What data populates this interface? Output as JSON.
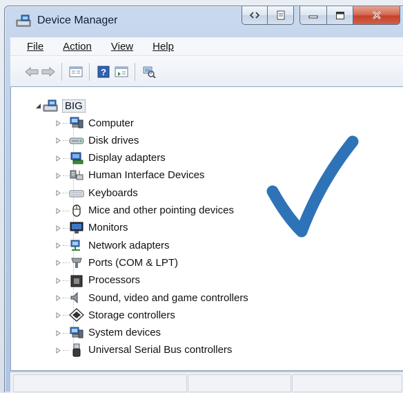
{
  "window": {
    "title": "Device Manager"
  },
  "menu": {
    "file": "File",
    "action": "Action",
    "view": "View",
    "help": "Help"
  },
  "toolbar": {
    "buttons": [
      "back-arrow-icon",
      "forward-arrow-icon",
      "properties-icon",
      "help-icon",
      "update-driver-icon",
      "scan-hardware-icon"
    ]
  },
  "tree": {
    "root": "BIG",
    "items": [
      {
        "label": "Computer",
        "icon": "computer-icon"
      },
      {
        "label": "Disk drives",
        "icon": "disk-drive-icon"
      },
      {
        "label": "Display adapters",
        "icon": "display-adapter-icon"
      },
      {
        "label": "Human Interface Devices",
        "icon": "hid-icon"
      },
      {
        "label": "Keyboards",
        "icon": "keyboard-icon"
      },
      {
        "label": "Mice and other pointing devices",
        "icon": "mouse-icon"
      },
      {
        "label": "Monitors",
        "icon": "monitor-icon"
      },
      {
        "label": "Network adapters",
        "icon": "network-adapter-icon"
      },
      {
        "label": "Ports (COM & LPT)",
        "icon": "port-icon"
      },
      {
        "label": "Processors",
        "icon": "processor-icon"
      },
      {
        "label": "Sound, video and game controllers",
        "icon": "sound-icon"
      },
      {
        "label": "Storage controllers",
        "icon": "storage-controller-icon"
      },
      {
        "label": "System devices",
        "icon": "system-device-icon"
      },
      {
        "label": "Universal Serial Bus controllers",
        "icon": "usb-icon"
      }
    ]
  },
  "colors": {
    "checkmark": "#2e73b8",
    "titlebar": "#b9cde7",
    "close_button": "#c2432a"
  }
}
